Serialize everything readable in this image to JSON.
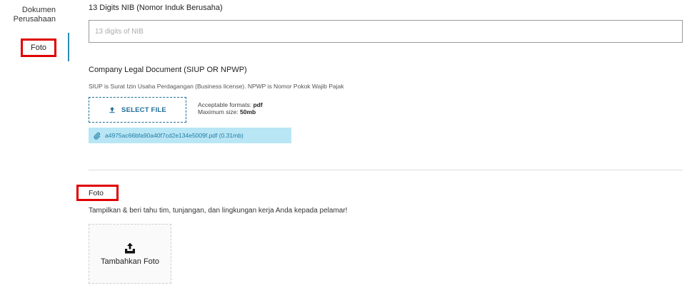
{
  "sidebar": {
    "items": [
      {
        "label": "Dokumen Perusahaan"
      },
      {
        "label": "Foto"
      }
    ]
  },
  "nib": {
    "label": "13 Digits NIB (Nomor Induk Berusaha)",
    "placeholder": "13 digits of NIB",
    "value": ""
  },
  "legal_doc": {
    "title": "Company Legal Document (SIUP OR NPWP)",
    "help": "SIUP is Surat Izin Usaha Perdagangan (Business license). NPWP is Nomor Pokok Wajib Pajak",
    "select_button": "SELECT FILE",
    "formats_label": "Acceptable formats: ",
    "formats_value": "pdf",
    "size_label": "Maximum size: ",
    "size_value": "50mb",
    "uploaded_file": "a4975ac66bfa90a40f7cd2e134e5009f.pdf (0.31mb)"
  },
  "foto": {
    "title": "Foto",
    "description": "Tampilkan & beri tahu tim, tunjangan, dan lingkungan kerja Anda kepada pelamar!",
    "add_label": "Tambahkan Foto"
  },
  "colors": {
    "accent": "#1f6d97",
    "chip_bg": "#b9e6f5",
    "highlight": "#e00000"
  },
  "icons": {
    "upload": "upload-icon",
    "attachment": "paperclip-icon",
    "add_photo": "upload-tray-icon"
  }
}
